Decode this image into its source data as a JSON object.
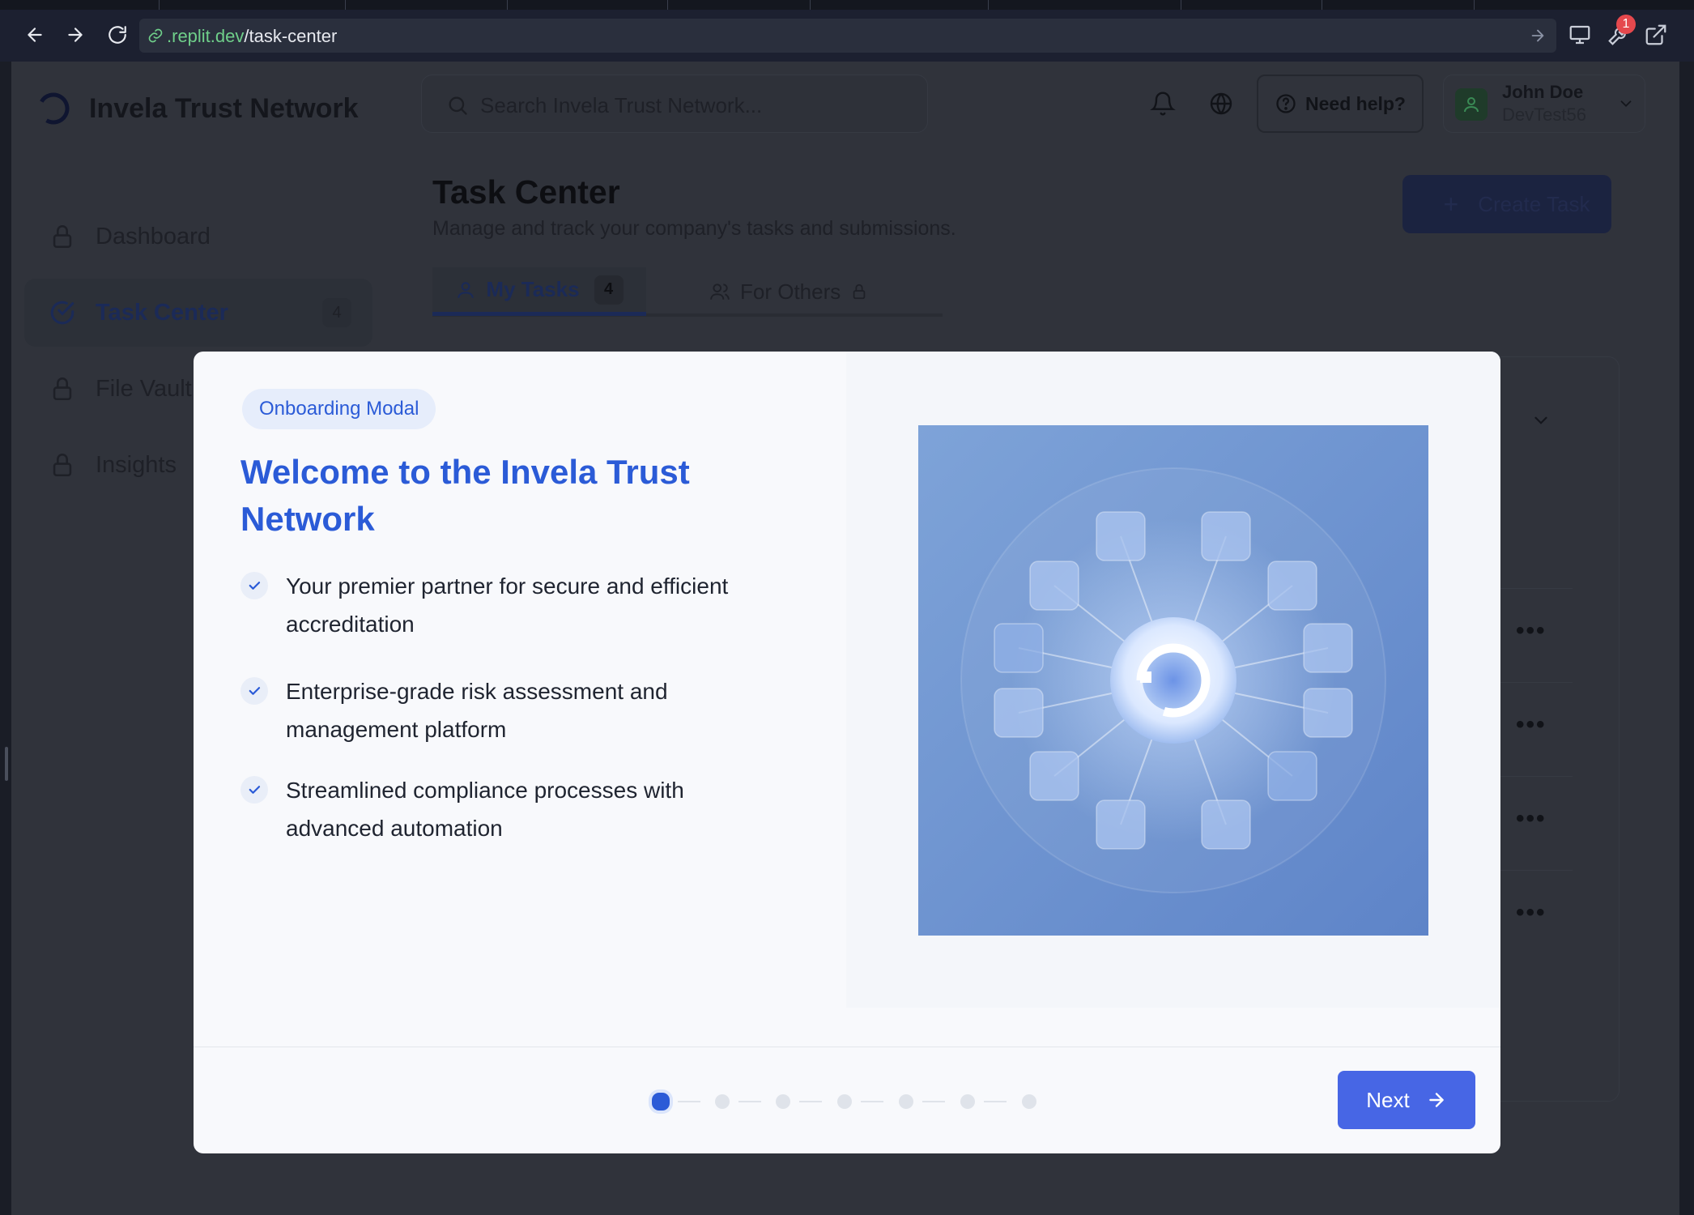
{
  "browser": {
    "url_host": ".replit.dev",
    "url_path": "/task-center",
    "notification_count": "1"
  },
  "app": {
    "brand_name": "Invela Trust Network",
    "search_placeholder": "Search Invela Trust Network...",
    "help_label": "Need help?",
    "user": {
      "name": "John Doe",
      "org": "DevTest56"
    }
  },
  "sidebar": {
    "items": [
      {
        "label": "Dashboard",
        "icon": "lock-icon",
        "active": false
      },
      {
        "label": "Task Center",
        "icon": "check-circle-icon",
        "active": true,
        "count": "4"
      },
      {
        "label": "File Vault",
        "icon": "lock-icon",
        "active": false
      },
      {
        "label": "Insights",
        "icon": "lock-icon",
        "active": false
      }
    ]
  },
  "page": {
    "title": "Task Center",
    "subtitle": "Manage and track your company's tasks and submissions.",
    "create_button": "Create Task",
    "tabs": [
      {
        "label": "My Tasks",
        "count": "4",
        "active": true
      },
      {
        "label": "For Others",
        "locked": true,
        "active": false
      }
    ]
  },
  "modal": {
    "tag": "Onboarding Modal",
    "title": "Welcome to the Invela Trust Network",
    "features": [
      "Your premier partner for secure and efficient accreditation",
      "Enterprise-grade risk assessment and management platform",
      "Streamlined compliance processes with advanced automation"
    ],
    "steps_total": 7,
    "current_step": 1,
    "next_label": "Next"
  },
  "colors": {
    "accent": "#2b5bd7",
    "button": "#4766e5",
    "overlay": "#30333b"
  }
}
